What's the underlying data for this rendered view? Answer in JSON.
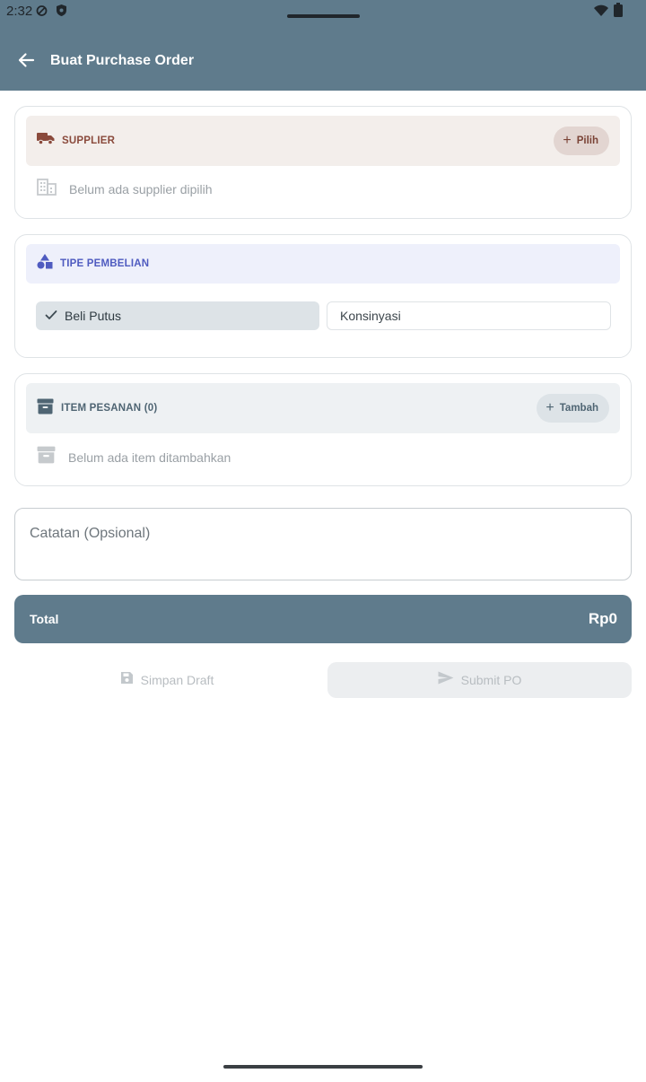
{
  "status_bar": {
    "time": "2:32"
  },
  "appbar": {
    "title": "Buat Purchase Order"
  },
  "supplier": {
    "heading": "SUPPLIER",
    "action_label": "Pilih",
    "empty_text": "Belum ada supplier dipilih"
  },
  "purchase_type": {
    "heading": "TIPE PEMBELIAN",
    "options": [
      "Beli Putus",
      "Konsinyasi"
    ],
    "selected": "Beli Putus"
  },
  "items": {
    "heading": "ITEM PESANAN (0)",
    "action_label": "Tambah",
    "empty_text": "Belum ada item ditambahkan"
  },
  "notes": {
    "placeholder": "Catatan (Opsional)"
  },
  "total": {
    "label": "Total",
    "value": "Rp0"
  },
  "actions": {
    "draft_label": "Simpan Draft",
    "submit_label": "Submit PO"
  },
  "colors": {
    "primary": "#5f7b8c",
    "supplier_accent": "#8a4a3c",
    "supplier_bg": "#f3eeeb",
    "type_accent": "#4f5bc0",
    "type_bg": "#eef0fb",
    "items_accent": "#4f6573",
    "items_bg": "#eef1f3"
  },
  "icons": {
    "back": "arrow-left-icon",
    "supplier": "truck-icon",
    "supplier_empty": "building-icon",
    "type": "shapes-icon",
    "items": "archive-icon",
    "items_empty": "archive-icon",
    "draft": "save-icon",
    "submit": "send-icon"
  }
}
